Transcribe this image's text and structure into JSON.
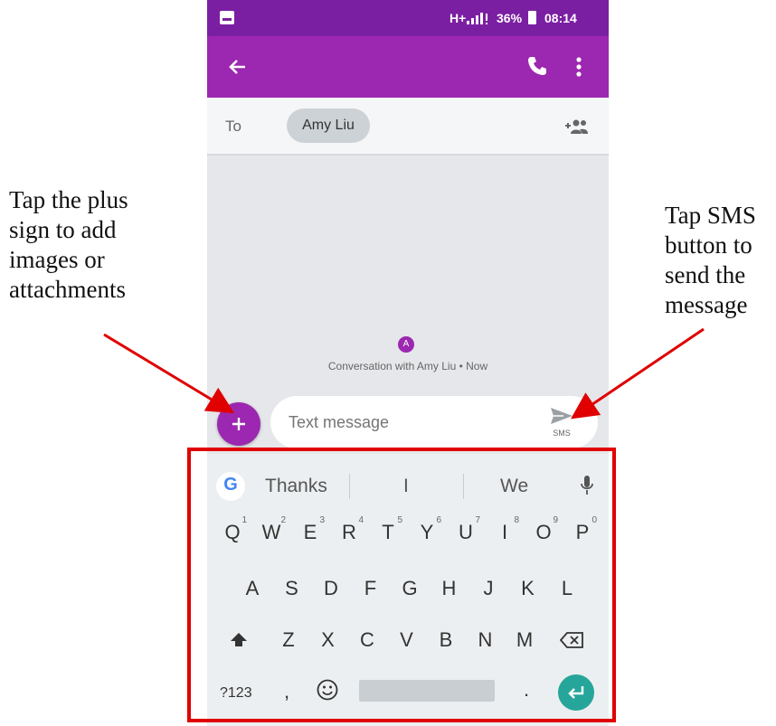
{
  "annotations": {
    "left_text": "Tap the plus\nsign to add\nimages or\nattachments",
    "right_text": "Tap SMS\nbutton to\nsend the\nmessage"
  },
  "status_bar": {
    "network": "H+",
    "battery": "36%",
    "time": "08:14"
  },
  "to_field": {
    "label": "To",
    "recipient": "Amy Liu"
  },
  "conversation": {
    "avatar_letter": "A",
    "info": "Conversation with Amy Liu • Now"
  },
  "compose": {
    "placeholder": "Text message",
    "send_label": "SMS"
  },
  "keyboard": {
    "suggestions": [
      "Thanks",
      "I",
      "We"
    ],
    "row1": [
      {
        "k": "Q",
        "n": "1"
      },
      {
        "k": "W",
        "n": "2"
      },
      {
        "k": "E",
        "n": "3"
      },
      {
        "k": "R",
        "n": "4"
      },
      {
        "k": "T",
        "n": "5"
      },
      {
        "k": "Y",
        "n": "6"
      },
      {
        "k": "U",
        "n": "7"
      },
      {
        "k": "I",
        "n": "8"
      },
      {
        "k": "O",
        "n": "9"
      },
      {
        "k": "P",
        "n": "0"
      }
    ],
    "row2": [
      "A",
      "S",
      "D",
      "F",
      "G",
      "H",
      "J",
      "K",
      "L"
    ],
    "row3": [
      "Z",
      "X",
      "C",
      "V",
      "B",
      "N",
      "M"
    ],
    "symbols_label": "?123",
    "comma": ",",
    "period": "."
  },
  "colors": {
    "status_bar": "#7b1fa2",
    "toolbar": "#9c27b0",
    "fab": "#9c27b0",
    "enter_key": "#26a69a",
    "highlight_frame": "#e00000",
    "arrow": "#e00000"
  }
}
